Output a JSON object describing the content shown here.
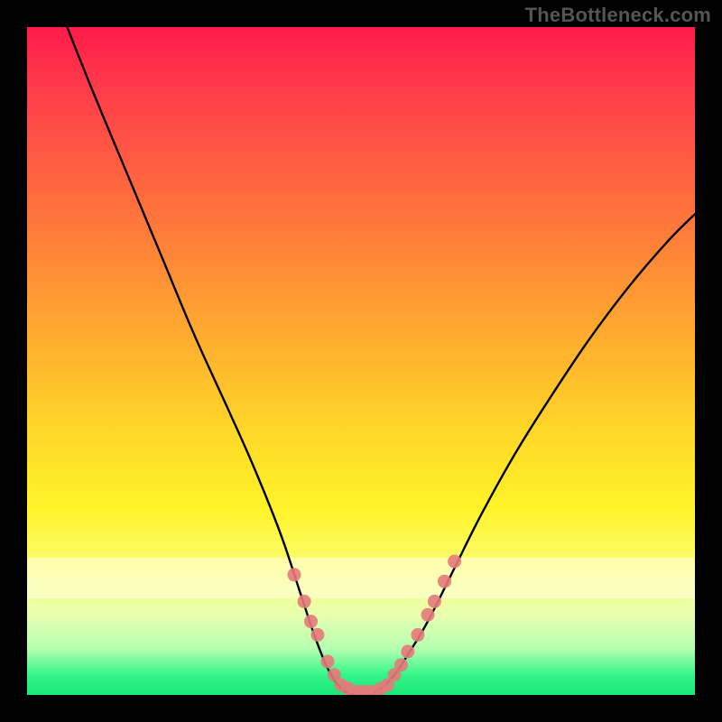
{
  "watermark": "TheBottleneck.com",
  "chart_data": {
    "type": "line",
    "title": "",
    "xlabel": "",
    "ylabel": "",
    "xlim": [
      0,
      100
    ],
    "ylim": [
      0,
      100
    ],
    "series": [
      {
        "name": "bottleneck-curve",
        "x": [
          6,
          10,
          15,
          20,
          25,
          30,
          34,
          38,
          41,
          43,
          45,
          47,
          49,
          51,
          53,
          55,
          57,
          60,
          64,
          68,
          73,
          78,
          84,
          90,
          96,
          100
        ],
        "values": [
          100,
          90,
          78,
          66,
          54,
          43,
          34,
          24,
          15,
          9,
          4,
          1,
          0,
          0,
          1,
          3,
          6,
          11,
          19,
          27,
          36,
          44,
          53,
          61,
          68,
          72
        ]
      }
    ],
    "markers": {
      "name": "highlighted-points",
      "color": "#e47a7a",
      "x": [
        40,
        41.5,
        42.5,
        43.5,
        45,
        46,
        47,
        48,
        49,
        50,
        51,
        52,
        53,
        54,
        55,
        56,
        57,
        58.5,
        60,
        61,
        62.5,
        64
      ],
      "values": [
        18,
        14,
        11,
        9,
        5,
        3,
        1.5,
        1,
        0.5,
        0.5,
        0.5,
        0.5,
        1,
        1.5,
        3,
        4.5,
        6.5,
        9,
        12,
        14,
        17,
        20
      ]
    },
    "background_gradient": {
      "stops": [
        {
          "pos": 0,
          "color": "#ff1a4a"
        },
        {
          "pos": 25,
          "color": "#ff6a3e"
        },
        {
          "pos": 60,
          "color": "#ffd628"
        },
        {
          "pos": 82,
          "color": "#fbff7a"
        },
        {
          "pos": 97,
          "color": "#35f58a"
        },
        {
          "pos": 100,
          "color": "#19e878"
        }
      ]
    }
  }
}
